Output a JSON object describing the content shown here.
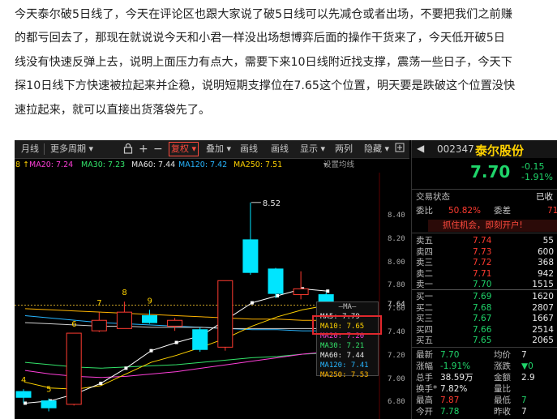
{
  "article": {
    "lines": [
      "今天泰尔破5日线了，今天在评论区也跟大家说了破5日线可以先减仓或者出场，不要把我们之前赚",
      "的都亏回去了，那现在就说说今天和小君一样没出场想博弈后面的操作干货来了，今天低开破5日",
      "线没有快速反弹上去，说明上面压力有点大，需要下来10日线附近找支撑，震荡一些日子，今天下",
      "探10日线下方快速被拉起来并企稳，说明短期支撑位在7.65这个位置，明天要是跌破这个位置没快",
      "速拉起来，就可以直接出货落袋先了。"
    ]
  },
  "toolbar": {
    "period": "月线",
    "more_period": "更多周期",
    "zoom_in": "+",
    "zoom_out": "−",
    "fuquan": "复权",
    "overlay": "叠加",
    "wide": "画线",
    "draw": "画线",
    "display": "显示",
    "eye": "两列",
    "hide": "隐藏",
    "lock_icon": "lock-icon",
    "expand_icon": "expand-icon"
  },
  "ma_row": {
    "ma10": "8 ↑",
    "ma20": "MA20: 7.24",
    "ma30": "MA30: 7.23",
    "ma60": "MA60: 7.44",
    "ma120": "MA120: 7.42",
    "ma250": "MA250: 7.51",
    "settings": "设置均线"
  },
  "colors": {
    "ma5": "#ffffff",
    "ma10": "#ffd200",
    "ma20": "#ff3fd9",
    "ma30": "#33e36a",
    "ma60": "#cfcfcf",
    "ma120": "#27b5ff",
    "ma250": "#ffb400",
    "up": "#ff3b30",
    "down": "#00e5ff"
  },
  "chart_data": {
    "type": "candlestick",
    "ylim": [
      6.72,
      8.72
    ],
    "price_ticks": [
      "8.40",
      "8.20",
      "8.00",
      "7.80",
      "7.64",
      "7.60",
      "7.40",
      "7.20",
      "7.00",
      "6.80"
    ],
    "high_marker": "8.52",
    "candles": [
      {
        "o": 6.9,
        "c": 6.85,
        "h": 6.92,
        "l": 6.8,
        "label": "4"
      },
      {
        "o": 6.82,
        "c": 6.76,
        "h": 6.84,
        "l": 6.73,
        "label": "5"
      },
      {
        "o": 6.79,
        "c": 7.4,
        "h": 7.4,
        "l": 6.78,
        "label": "6"
      },
      {
        "o": 7.42,
        "c": 7.51,
        "h": 7.58,
        "l": 7.41,
        "label": "7"
      },
      {
        "o": 7.44,
        "c": 7.58,
        "h": 7.67,
        "l": 7.44,
        "label": "8"
      },
      {
        "o": 7.55,
        "c": 7.49,
        "h": 7.6,
        "l": 7.48,
        "label": "9"
      },
      {
        "o": 7.46,
        "c": 7.51,
        "h": 7.53,
        "l": 7.42,
        "label": ""
      },
      {
        "o": 7.43,
        "c": 7.26,
        "h": 7.45,
        "l": 7.24,
        "label": ""
      },
      {
        "o": 7.28,
        "c": 7.85,
        "h": 7.85,
        "l": 7.25,
        "label": ""
      },
      {
        "o": 8.2,
        "c": 7.92,
        "h": 8.52,
        "l": 7.9,
        "label": ""
      },
      {
        "o": 7.95,
        "c": 7.74,
        "h": 7.96,
        "l": 7.7,
        "label": ""
      },
      {
        "o": 7.73,
        "c": 7.78,
        "h": 7.93,
        "l": 7.69,
        "label": ""
      },
      {
        "o": 7.73,
        "c": 7.63,
        "h": 7.75,
        "l": 7.62,
        "label": ""
      }
    ],
    "ma5_path": [
      6.8,
      6.82,
      6.88,
      6.97,
      7.1,
      7.25,
      7.32,
      7.38,
      7.52,
      7.66,
      7.72,
      7.78,
      7.76
    ],
    "ma10_path": [
      6.98,
      6.93,
      6.92,
      6.95,
      7.05,
      7.15,
      7.21,
      7.28,
      7.36,
      7.46,
      7.54,
      7.6,
      7.64
    ],
    "ma20_path": [
      7.08,
      7.05,
      7.03,
      7.02,
      7.03,
      7.05,
      7.07,
      7.1,
      7.13,
      7.16,
      7.19,
      7.22,
      7.24
    ],
    "ma30_path": [
      7.15,
      7.13,
      7.11,
      7.1,
      7.11,
      7.12,
      7.13,
      7.15,
      7.17,
      7.19,
      7.2,
      7.22,
      7.23
    ],
    "ma60_path": [
      7.49,
      7.48,
      7.47,
      7.46,
      7.46,
      7.45,
      7.45,
      7.45,
      7.44,
      7.44,
      7.44,
      7.44,
      7.44
    ],
    "ma120_path": [
      7.55,
      7.53,
      7.51,
      7.49,
      7.48,
      7.47,
      7.46,
      7.45,
      7.44,
      7.43,
      7.43,
      7.42,
      7.42
    ],
    "ma250_path": [
      7.61,
      7.6,
      7.59,
      7.58,
      7.57,
      7.56,
      7.55,
      7.54,
      7.53,
      7.52,
      7.52,
      7.51,
      7.51
    ],
    "current_price_line": 7.64
  },
  "ma_box": {
    "header": "MA",
    "lines": [
      "MA5:  7.79",
      "MA10: 7.65",
      "MA20: 7.20",
      "MA30: 7.21",
      "MA60: 7.44",
      "MA120: 7.41",
      "MA250: 7.53"
    ]
  },
  "quote": {
    "code": "002347",
    "name": "泰尔股份",
    "price": "7.70",
    "change": "-0.15",
    "change_pct": "-1.91%",
    "trade_status": "交易状态",
    "trade_status_val": "已收",
    "weibi_label": "委比",
    "weibi_val": "50.82%",
    "weicha_label": "委差",
    "weicha_val": "71",
    "banner": "抓住机会，即刻开户!",
    "asks": [
      {
        "label": "卖五",
        "price": "7.74",
        "vol": "55"
      },
      {
        "label": "卖四",
        "price": "7.73",
        "vol": "600"
      },
      {
        "label": "卖三",
        "price": "7.72",
        "vol": "368"
      },
      {
        "label": "卖二",
        "price": "7.71",
        "vol": "942"
      },
      {
        "label": "卖一",
        "price": "7.70",
        "vol": "1515"
      }
    ],
    "bids": [
      {
        "label": "买一",
        "price": "7.69",
        "vol": "1620"
      },
      {
        "label": "买二",
        "price": "7.68",
        "vol": "2807"
      },
      {
        "label": "买三",
        "price": "7.67",
        "vol": "1667"
      },
      {
        "label": "买四",
        "price": "7.66",
        "vol": "2514"
      },
      {
        "label": "买五",
        "price": "7.65",
        "vol": "2065"
      }
    ],
    "stats": [
      {
        "l1": "最新",
        "v1": "7.70",
        "c1": "grn",
        "l2": "均价",
        "v2": "7",
        "c2": "wht"
      },
      {
        "l1": "涨幅",
        "v1": "-1.91%",
        "c1": "grn",
        "l2": "涨跌",
        "v2": "▼0",
        "c2": "grn"
      },
      {
        "l1": "总手",
        "v1": "38.59万",
        "c1": "wht",
        "l2": "金额",
        "v2": "2.9",
        "c2": "wht"
      },
      {
        "l1": "换手*",
        "v1": "7.82%",
        "c1": "wht",
        "l2": "量比",
        "v2": "",
        "c2": "wht"
      },
      {
        "l1": "最高",
        "v1": "7.87",
        "c1": "red",
        "l2": "最低",
        "v2": "7",
        "c2": "grn"
      },
      {
        "l1": "今开",
        "v1": "7.78",
        "c1": "grn",
        "l2": "昨收",
        "v2": "7",
        "c2": "wht"
      }
    ]
  }
}
